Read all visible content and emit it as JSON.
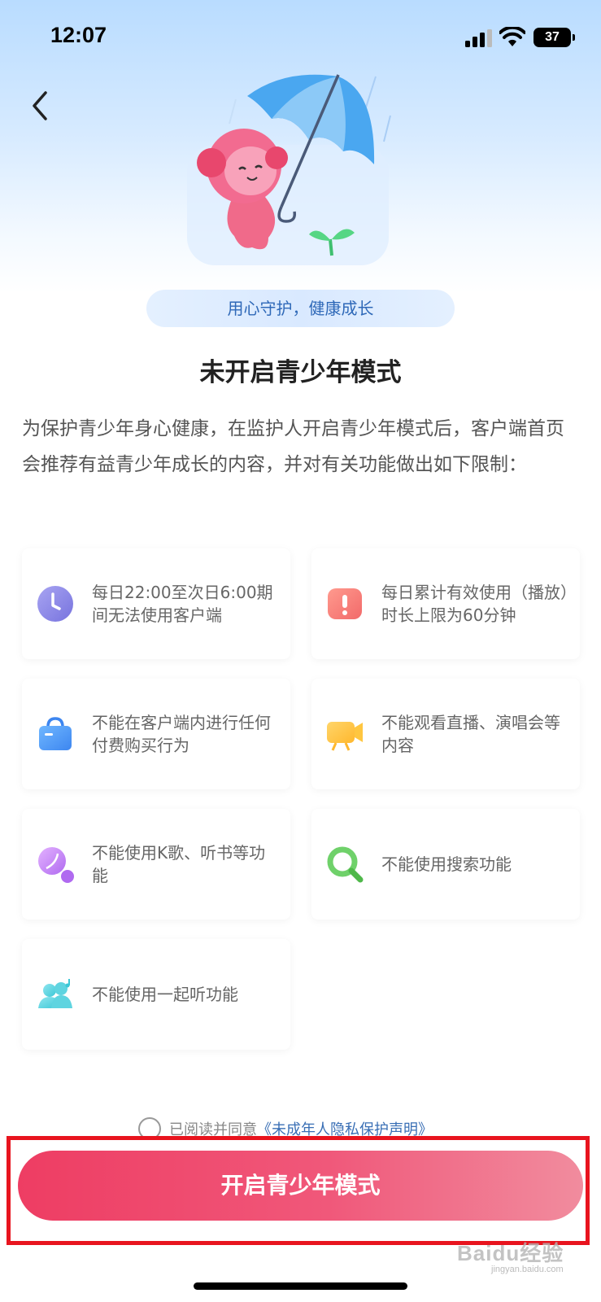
{
  "status_bar": {
    "time": "12:07",
    "battery": "37"
  },
  "header": {
    "back_icon": "chevron-left-icon"
  },
  "slogan": "用心守护，健康成长",
  "title": "未开启青少年模式",
  "intro": "为保护青少年身心健康，在监护人开启青少年模式后，客户端首页会推荐有益青少年成长的内容，并对有关功能做出如下限制：",
  "restrictions": [
    {
      "icon": "clock-icon",
      "text": "每日22:00至次日6:00期间无法使用客户端"
    },
    {
      "icon": "time-limit-icon",
      "text": "每日累计有效使用（播放）时长上限为60分钟"
    },
    {
      "icon": "shopping-bag-icon",
      "text": "不能在客户端内进行任何付费购买行为"
    },
    {
      "icon": "video-camera-icon",
      "text": "不能观看直播、演唱会等内容"
    },
    {
      "icon": "microphone-icon",
      "text": "不能使用K歌、听书等功能"
    },
    {
      "icon": "search-icon",
      "text": "不能使用搜索功能"
    },
    {
      "icon": "listen-together-icon",
      "text": "不能使用一起听功能"
    }
  ],
  "agreement": {
    "prefix": "已阅读并同意",
    "link": "《未成年人隐私保护声明》"
  },
  "enable_button": "开启青少年模式",
  "watermark": {
    "main": "Baidu经验",
    "sub": "jingyan.baidu.com"
  },
  "colors": {
    "accent": "#ee3d63",
    "link": "#3a6fb5",
    "highlight": "#e8141e"
  }
}
